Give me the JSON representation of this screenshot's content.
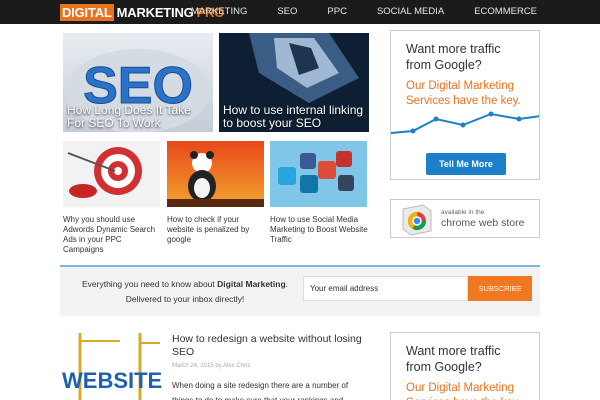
{
  "header": {
    "logo_part1": "DIGITAL",
    "logo_part2": "MARKETING",
    "logo_part3": "PRO",
    "nav": [
      "MARKETING",
      "SEO",
      "PPC",
      "SOCIAL MEDIA",
      "ECOMMERCE"
    ]
  },
  "featured": [
    {
      "title": "How Long Does It Take For SEO To Work",
      "image_text": "SEO"
    },
    {
      "title": "How to use internal linking to boost your SEO"
    }
  ],
  "thumbs": [
    {
      "title": "Why you should use Adwords Dynamic Search Ads in your PPC Campaigns"
    },
    {
      "title": "How to check if your website is penalized by google"
    },
    {
      "title": "How to use Social Media Marketing to Boost Website Traffic"
    }
  ],
  "ad": {
    "headline_1": "Want more traffic",
    "headline_2": "from Google?",
    "sub_1": "Our Digital Marketing",
    "sub_2": "Services have the key.",
    "button": "Tell Me More"
  },
  "chrome_store": {
    "small": "available in the",
    "big": "chrome web store"
  },
  "newsletter": {
    "pre": "Everything you need to know about",
    "strong": "Digital Marketing",
    "post": ".",
    "line2": "Delivered to your inbox directly!",
    "email_placeholder": "Your email address",
    "button": "SUBSCRIBE"
  },
  "post": {
    "title": "How to redesign a website without losing SEO",
    "meta": "March 24, 2015 by Alex Chris",
    "excerpt": "When doing a site redesign there are a number of things to do to make sure that your rankings and",
    "image_text": "WEBSITE"
  },
  "colors": {
    "accent": "#e8731f",
    "button_blue": "#1b7fc9",
    "nav_bg": "#1b1b1b"
  }
}
